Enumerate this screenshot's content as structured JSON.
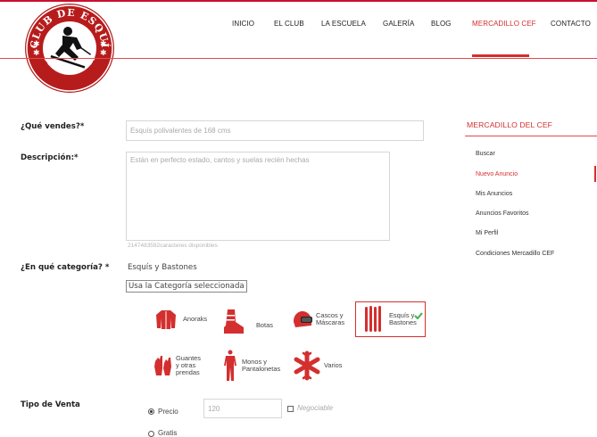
{
  "logo": {
    "top_text": "CLUB DE ESQUÍ",
    "bottom_text": "FAMILIAR"
  },
  "nav": {
    "items": [
      {
        "label": "INICIO"
      },
      {
        "label": "EL CLUB"
      },
      {
        "label": "LA ESCUELA"
      },
      {
        "label": "GALERÍA"
      },
      {
        "label": "BLOG"
      },
      {
        "label": "MERCADILLO CEF"
      },
      {
        "label": "CONTACTO"
      }
    ],
    "active": "MERCADILLO CEF"
  },
  "form": {
    "sell_label": "¿Qué vendes?*",
    "sell_placeholder": "Esquís polivalentes de 168 cms",
    "desc_label": "Descripción:*",
    "desc_placeholder": "Están en perfecto estado, cantos y suelas recién hechas",
    "chars_left": "2147483592caracteres disponibles",
    "category_label": "¿En qué categoría? *",
    "category_value": "Esquís y Bastones",
    "use_category_button": "Usa la Categoría seleccionada",
    "categories": [
      {
        "label": "Anoraks",
        "icon": "anorak-icon"
      },
      {
        "label": "Botas",
        "icon": "boot-icon"
      },
      {
        "label": "Cascos y Máscaras",
        "line1": "Cascos y",
        "line2": "Máscaras",
        "icon": "helmet-icon"
      },
      {
        "label": "Esquís y Bastones",
        "line1": "Esquís y",
        "line2": "Bastones",
        "icon": "skis-icon",
        "selected": true
      },
      {
        "label": "Guantes y otras prendas",
        "line1": "Guantes",
        "line2": "y otras",
        "line3": "prendas",
        "icon": "gloves-icon"
      },
      {
        "label": "Monos y Pantalonetas",
        "line1": "Monos y",
        "line2": "Pantalonetas",
        "icon": "suit-icon"
      },
      {
        "label": "Varios",
        "icon": "snowflake-icon"
      }
    ],
    "sale_type_label": "Tipo de Venta",
    "price_option": "Precio",
    "price_value": "120",
    "negotiable_label": "Negociable",
    "free_option": "Gratis"
  },
  "sidebar": {
    "title": "MERCADILLO DEL CEF",
    "items": [
      {
        "label": "Buscar"
      },
      {
        "label": "Nuevo Anuncio",
        "active": true
      },
      {
        "label": "Mis Anuncios"
      },
      {
        "label": "Anuncios Favoritos"
      },
      {
        "label": "Mi Perfil"
      },
      {
        "label": "Condiciones Mercadillo CEF"
      }
    ]
  },
  "colors": {
    "accent": "#d32f2f",
    "text": "#222222",
    "muted": "#aaaaaa",
    "border": "#d6d6d6"
  }
}
